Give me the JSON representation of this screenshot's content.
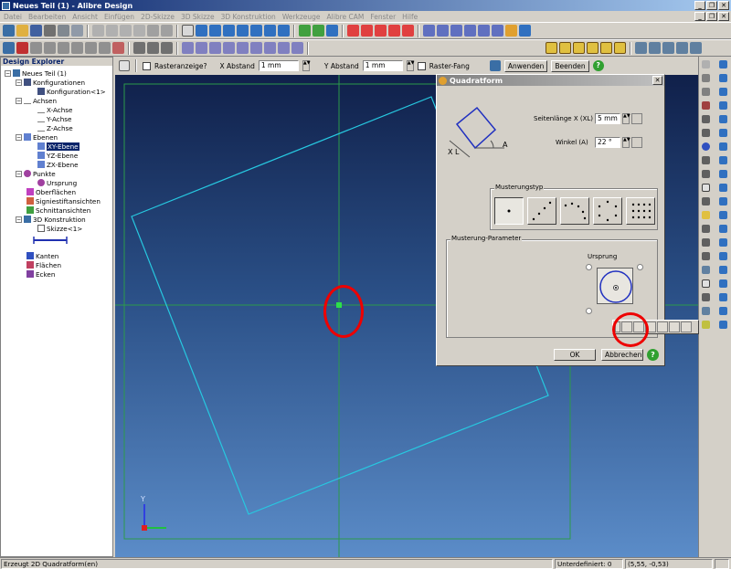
{
  "window": {
    "title": "Neues Teil (1) - Alibre Design"
  },
  "menu": [
    "Datei",
    "Bearbeiten",
    "Ansicht",
    "Einfügen",
    "2D-Skizze",
    "3D Skizze",
    "3D Konstruktion",
    "Werkzeuge",
    "Alibre CAM",
    "Fenster",
    "Hilfe"
  ],
  "window_controls": {
    "minimize": "_",
    "maximize": "❐",
    "close": "✕"
  },
  "sketchbar": {
    "raster_label": "Rasteranzeige?",
    "x_label": "X Abstand",
    "x_value": "1 mm",
    "y_label": "Y Abstand",
    "y_value": "1 mm",
    "snap_label": "Raster-Fang",
    "apply": "Anwenden",
    "finish": "Beenden",
    "help": "?"
  },
  "explorer": {
    "title": "Design Explorer",
    "items": [
      {
        "label": "Neues Teil (1)",
        "icon": "part-icon"
      },
      {
        "label": "Konfigurationen",
        "icon": "config-icon"
      },
      {
        "label": "Konfiguration<1>",
        "icon": "config-icon"
      },
      {
        "label": "Achsen",
        "icon": "axis-icon"
      },
      {
        "label": "X-Achse",
        "icon": "axis-icon"
      },
      {
        "label": "Y-Achse",
        "icon": "axis-icon"
      },
      {
        "label": "Z-Achse",
        "icon": "axis-icon"
      },
      {
        "label": "Ebenen",
        "icon": "plane-icon"
      },
      {
        "label": "XY-Ebene",
        "icon": "plane-icon"
      },
      {
        "label": "YZ-Ebene",
        "icon": "plane-icon"
      },
      {
        "label": "ZX-Ebene",
        "icon": "plane-icon"
      },
      {
        "label": "Punkte",
        "icon": "point-icon"
      },
      {
        "label": "Ursprung",
        "icon": "point-icon"
      },
      {
        "label": "Oberflächen",
        "icon": "surface-icon"
      },
      {
        "label": "Signiestiftansichten",
        "icon": "view-icon"
      },
      {
        "label": "Schnittansichten",
        "icon": "section-icon"
      },
      {
        "label": "3D Konstruktion",
        "icon": "construction-icon"
      },
      {
        "label": "Skizze<1>",
        "icon": "sketch-icon"
      },
      {
        "label": "Kanten",
        "icon": "edge-icon"
      },
      {
        "label": "Flächen",
        "icon": "face-icon"
      },
      {
        "label": "Ecken",
        "icon": "vertex-icon"
      }
    ]
  },
  "dialog": {
    "title": "Quadratform",
    "close": "✕",
    "side_label": "Seitenlänge X (XL)",
    "side_value": "5 mm",
    "angle_label": "Winkel (A)",
    "angle_value": "22 °",
    "diagram_xl": "X L",
    "diagram_a": "A",
    "pattern_group": "Musterungstyp",
    "param_group": "Musterung-Parameter",
    "origin_label": "Ursprung",
    "ok": "OK",
    "cancel": "Abbrechen",
    "help": "?"
  },
  "axis": {
    "y": "Y"
  },
  "status": {
    "message": "Erzeugt 2D Quadratform(en)",
    "undefined": "Unterdefiniert: 0",
    "coords": "(5,55, -0,53)"
  }
}
